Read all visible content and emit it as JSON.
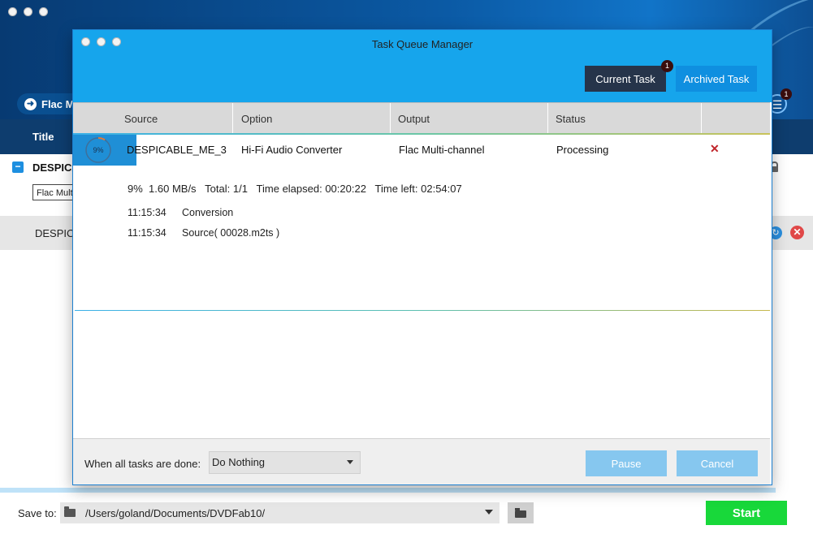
{
  "background_window": {
    "profile_label": "Flac Mu",
    "column_title": "Title",
    "row1_name": "DESPICA",
    "row1_option": "Flac Multi",
    "row2_name": "DESPICA",
    "queue_badge": "1",
    "save_to_label": "Save to:",
    "save_to_path": "/Users/goland/Documents/DVDFab10/",
    "start_label": "Start"
  },
  "dialog": {
    "title": "Task Queue Manager",
    "tabs": [
      {
        "label": "Current Task",
        "badge": "1",
        "active": true
      },
      {
        "label": "Archived Task",
        "active": false
      }
    ],
    "columns": [
      "Source",
      "Option",
      "Output",
      "Status"
    ],
    "task": {
      "progress_label": "9%",
      "progress_fraction": 0.09,
      "source": "DESPICABLE_ME_3",
      "option": "Hi-Fi Audio Converter",
      "output": "Flac Multi-channel",
      "status": "Processing",
      "delete_glyph": "✕"
    },
    "stats": {
      "percent": "9%",
      "speed": "1.60 MB/s",
      "total": "Total: 1/1",
      "elapsed": "Time elapsed: 00:20:22",
      "left": "Time left: 02:54:07"
    },
    "log": [
      {
        "time": "11:15:34",
        "message": "Conversion"
      },
      {
        "time": "11:15:34",
        "message": "Source( 00028.m2ts )"
      }
    ],
    "footer": {
      "when_done_label": "When all tasks are done:",
      "when_done_value": "Do Nothing",
      "pause_label": "Pause",
      "cancel_label": "Cancel"
    }
  },
  "colors": {
    "dialog_header": "#16a5ec",
    "active_tab": "#26344a",
    "inactive_tab": "#0f8fe0",
    "start_button": "#18d83a",
    "disabled_button": "#86c7ef",
    "delete": "#c0242a"
  }
}
